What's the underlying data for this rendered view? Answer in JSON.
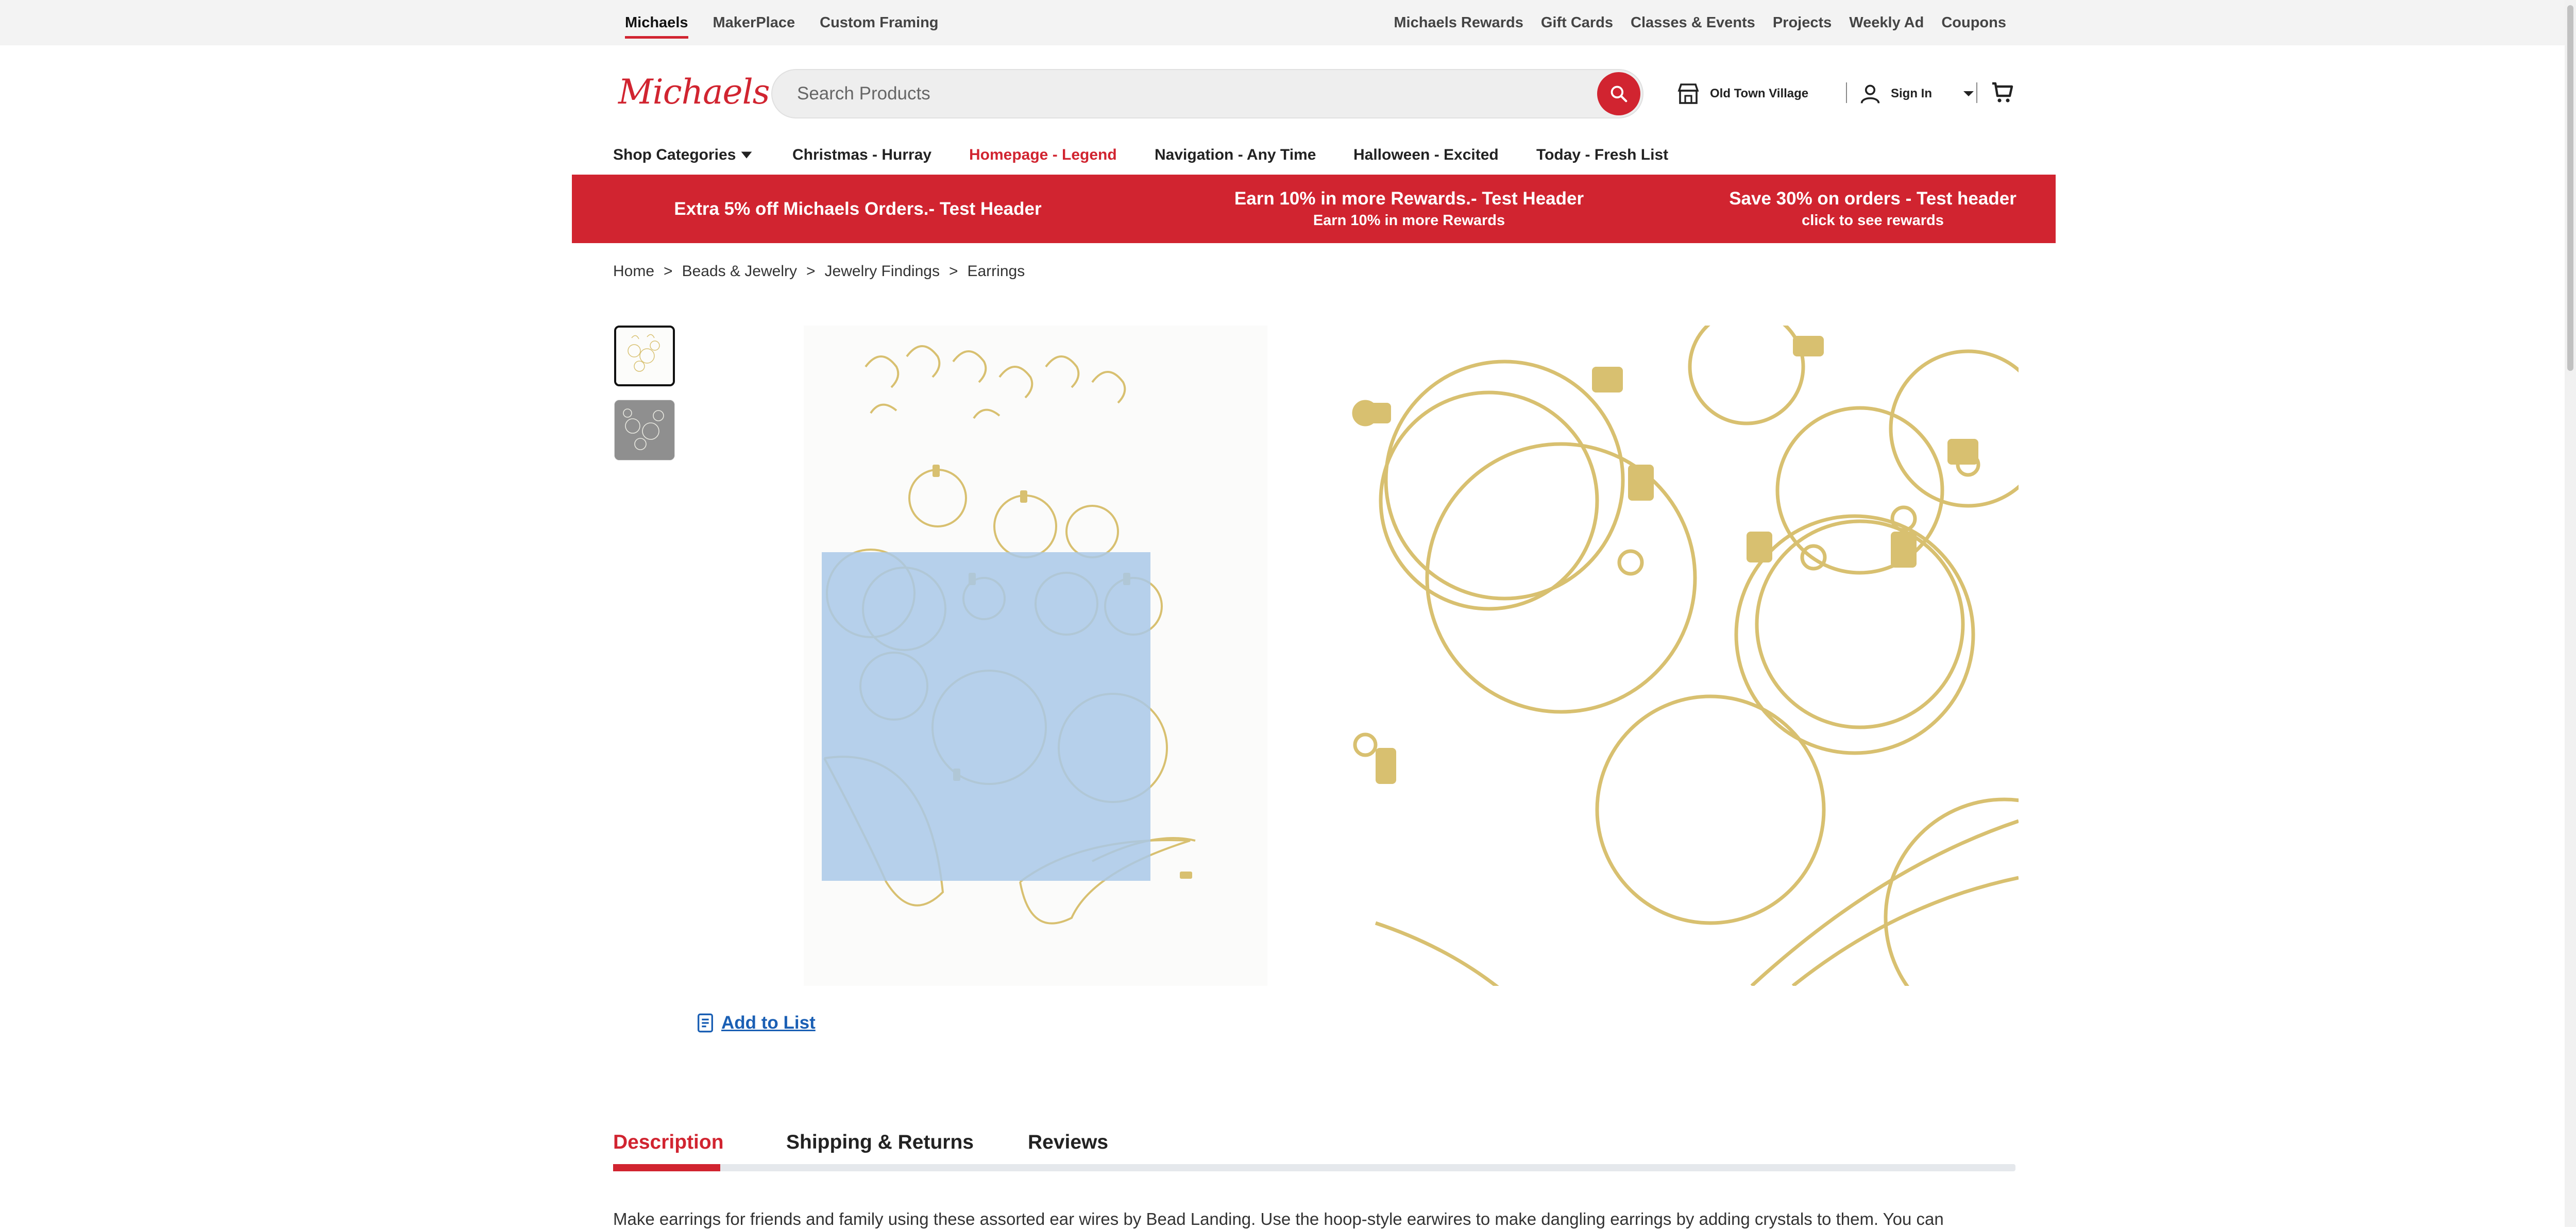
{
  "utility_bar": {
    "left_links": [
      {
        "label": "Michaels",
        "active": true
      },
      {
        "label": "MakerPlace",
        "active": false
      },
      {
        "label": "Custom Framing",
        "active": false
      }
    ],
    "right_links": [
      "Michaels Rewards",
      "Gift Cards",
      "Classes & Events",
      "Projects",
      "Weekly Ad",
      "Coupons"
    ]
  },
  "header": {
    "logo_text": "Michaels",
    "search": {
      "placeholder": "Search Products",
      "value": ""
    },
    "store_label": "Old Town Village",
    "signin_label": "Sign In"
  },
  "nav": {
    "shop_categories": "Shop Categories",
    "items": [
      {
        "label": "Christmas - Hurray",
        "highlight": false
      },
      {
        "label": "Homepage - Legend",
        "highlight": true
      },
      {
        "label": "Navigation - Any Time",
        "highlight": false
      },
      {
        "label": "Halloween - Excited",
        "highlight": false
      },
      {
        "label": "Today - Fresh List",
        "highlight": false
      }
    ]
  },
  "promo": [
    {
      "main": "Extra 5% off Michaels Orders.- Test Header",
      "sub": ""
    },
    {
      "main": "Earn 10% in more Rewards.- Test Header",
      "sub": "Earn 10% in more Rewards"
    },
    {
      "main": "Save 30% on orders - Test header",
      "sub": "click to see rewards"
    }
  ],
  "breadcrumb": [
    "Home",
    "Beads & Jewelry",
    "Jewelry Findings",
    "Earrings"
  ],
  "breadcrumb_separator": ">",
  "product": {
    "add_to_list": "Add to List"
  },
  "tabs": [
    {
      "label": "Description",
      "active": true
    },
    {
      "label": "Shipping & Returns",
      "active": false
    },
    {
      "label": "Reviews",
      "active": false
    }
  ],
  "description_text": "Make earrings for friends and family using these assorted ear wires by Bead Landing. Use the hoop-style earwires to make dangling earrings by adding crystals to them. You can",
  "colors": {
    "brand_red": "#d12430",
    "link_blue": "#1a5fb4",
    "gold": "#d9c274"
  }
}
